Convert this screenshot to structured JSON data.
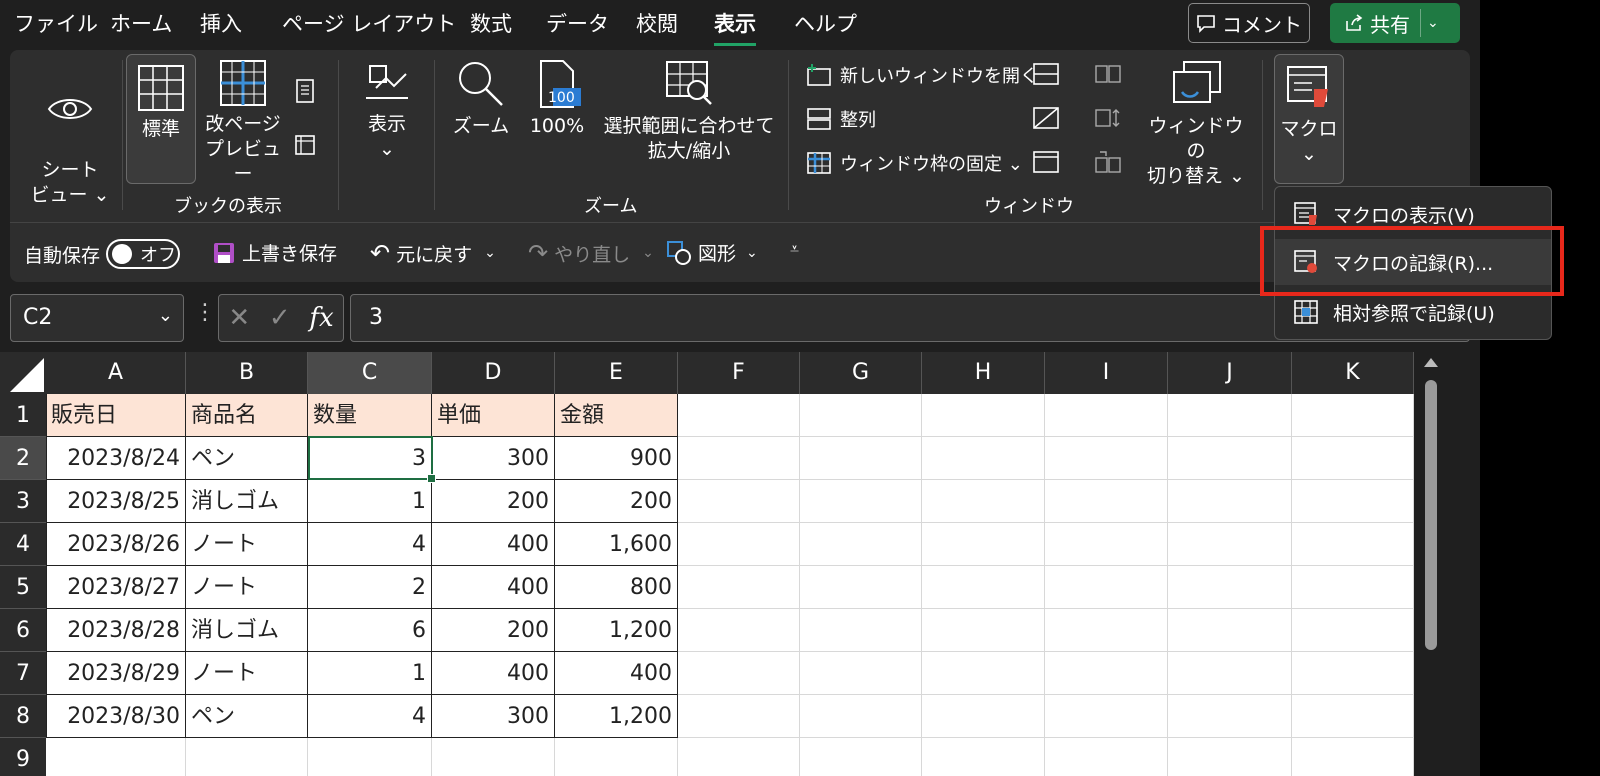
{
  "menubar": {
    "tabs": [
      "ファイル",
      "ホーム",
      "挿入",
      "ページ レイアウト",
      "数式",
      "データ",
      "校閲",
      "表示",
      "ヘルプ"
    ],
    "active_tab": "表示",
    "comment_label": "コメント",
    "share_label": "共有",
    "accent_color": "#21a366"
  },
  "ribbon": {
    "sheet_view": "シート\nビュー ⌄",
    "normal": "標準",
    "page_break": "改ページ\nプレビュー",
    "book_view_group": "ブックの表示",
    "show": "表示\n⌄",
    "zoom": "ズーム",
    "zoom100": "100%",
    "zoom_selection": "選択範囲に合わせて\n拡大/縮小",
    "zoom_group": "ズーム",
    "new_window": "新しいウィンドウを開く",
    "arrange": "整列",
    "freeze": "ウィンドウ枠の固定 ⌄",
    "switch_window": "ウィンドウの\n切り替え ⌄",
    "window_group": "ウィンドウ",
    "macro": "マクロ\n⌄",
    "zoom_badge": "100"
  },
  "qat": {
    "autosave": "自動保存",
    "autosave_state": "オフ",
    "save": "上書き保存",
    "undo": "元に戻す",
    "redo": "やり直し",
    "shapes": "図形"
  },
  "formula_bar": {
    "name_box": "C2",
    "fx": "fx",
    "formula": "3"
  },
  "sheet": {
    "columns": [
      "A",
      "B",
      "C",
      "D",
      "E",
      "F",
      "G",
      "H",
      "I",
      "J",
      "K"
    ],
    "row_numbers": [
      "1",
      "2",
      "3",
      "4",
      "5",
      "6",
      "7",
      "8",
      "9"
    ],
    "header": [
      "販売日",
      "商品名",
      "数量",
      "単価",
      "金額"
    ],
    "rows": [
      [
        "2023/8/24",
        "ペン",
        "3",
        "300",
        "900"
      ],
      [
        "2023/8/25",
        "消しゴム",
        "1",
        "200",
        "200"
      ],
      [
        "2023/8/26",
        "ノート",
        "4",
        "400",
        "1,600"
      ],
      [
        "2023/8/27",
        "ノート",
        "2",
        "400",
        "800"
      ],
      [
        "2023/8/28",
        "消しゴム",
        "6",
        "200",
        "1,200"
      ],
      [
        "2023/8/29",
        "ノート",
        "1",
        "400",
        "400"
      ],
      [
        "2023/8/30",
        "ペン",
        "4",
        "300",
        "1,200"
      ]
    ],
    "header_fill": "#fde4d6",
    "selected_cell": "C2"
  },
  "macro_menu": {
    "items": [
      "マクロの表示(V)",
      "マクロの記録(R)...",
      "相対参照で記録(U)"
    ],
    "highlight_color": "#e8281b"
  }
}
